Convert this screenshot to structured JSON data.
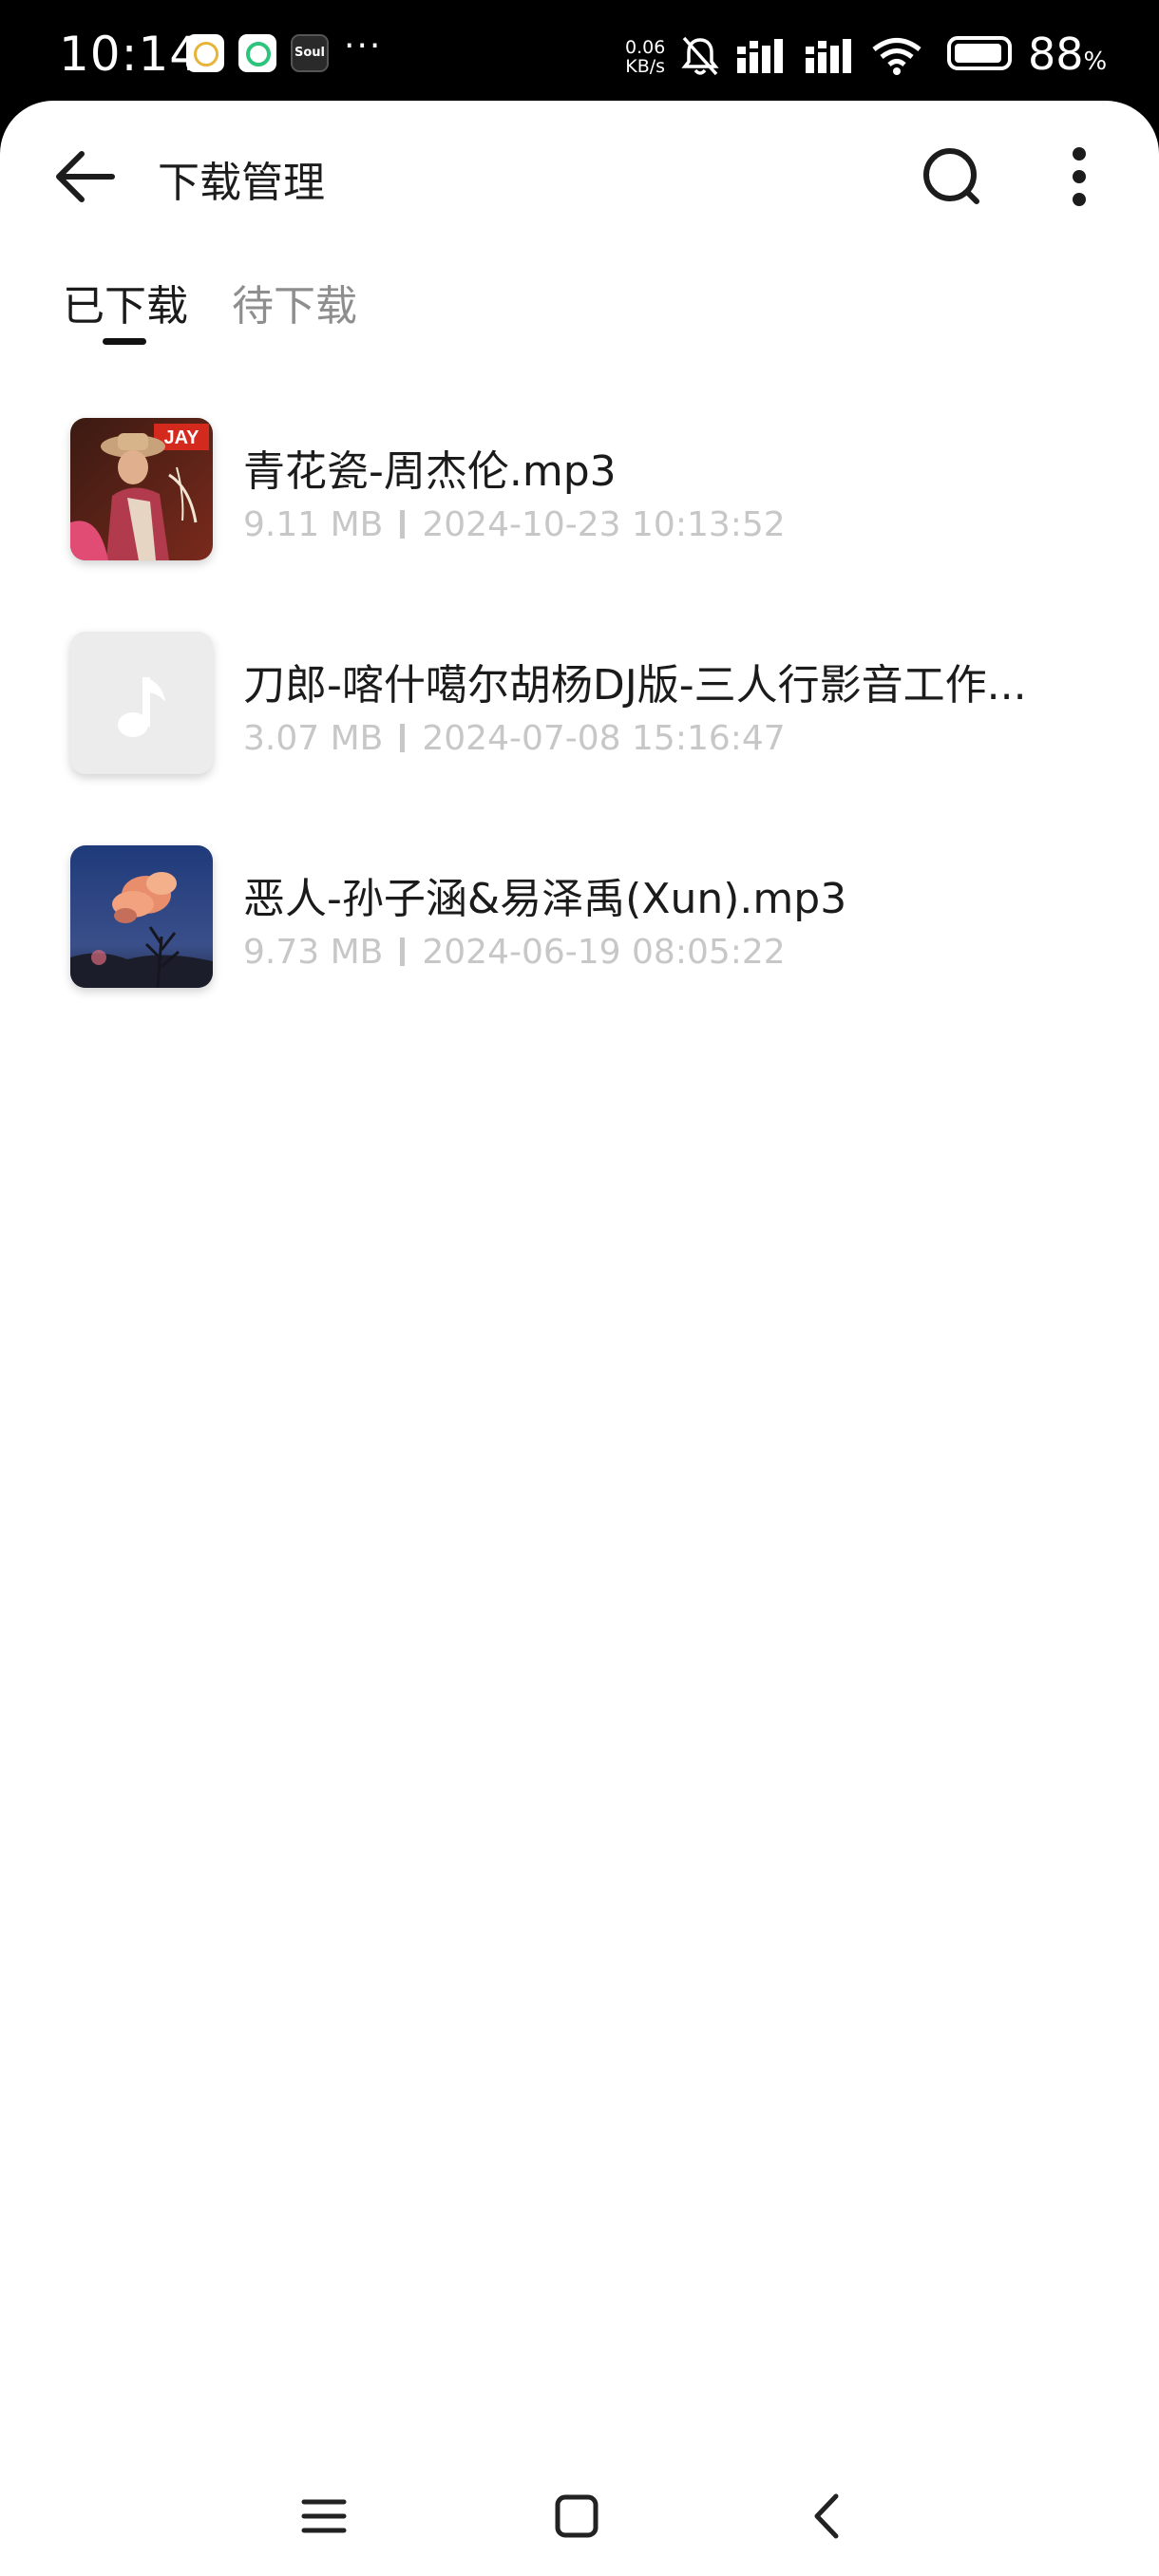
{
  "status_bar": {
    "time": "10:14",
    "more_indicator": "···",
    "net_speed_value": "0.06",
    "net_speed_unit": "KB/s",
    "battery_value": "88",
    "battery_unit": "%",
    "app3_label": "Soul",
    "icons": [
      "circle-app-icon",
      "green-ring-app-icon",
      "soul-app-icon",
      "bell-off-icon",
      "signal-icon",
      "signal-icon",
      "wifi-icon",
      "battery-icon"
    ]
  },
  "header": {
    "title": "下载管理",
    "back_icon": "arrow-left-icon",
    "search_icon": "search-icon",
    "more_icon": "more-vertical-icon"
  },
  "tabs": [
    {
      "label": "已下载",
      "active": true
    },
    {
      "label": "待下载",
      "active": false
    }
  ],
  "downloads": [
    {
      "title": "青花瓷-周杰伦.mp3",
      "size": "9.11 MB",
      "date": "2024-10-23 10:13:52",
      "thumb": "album-art-jay",
      "thumb_badge": "JAY"
    },
    {
      "title": "刀郎-喀什噶尔胡杨DJ版-三人行影音工作...",
      "size": "3.07 MB",
      "date": "2024-07-08 15:16:47",
      "thumb": "music-note-placeholder-icon"
    },
    {
      "title": "恶人-孙子涵&易泽禹(Xun).mp3",
      "size": "9.73 MB",
      "date": "2024-06-19 08:05:22",
      "thumb": "album-art-cloud-sky"
    }
  ],
  "nav": [
    "menu-icon",
    "home-square-icon",
    "back-chevron-icon"
  ],
  "colors": {
    "active_tab": "#1a1a1a",
    "inactive_tab": "#8e8e8e",
    "meta_text": "#c7c7c7",
    "status_bar_bg": "#000000"
  }
}
